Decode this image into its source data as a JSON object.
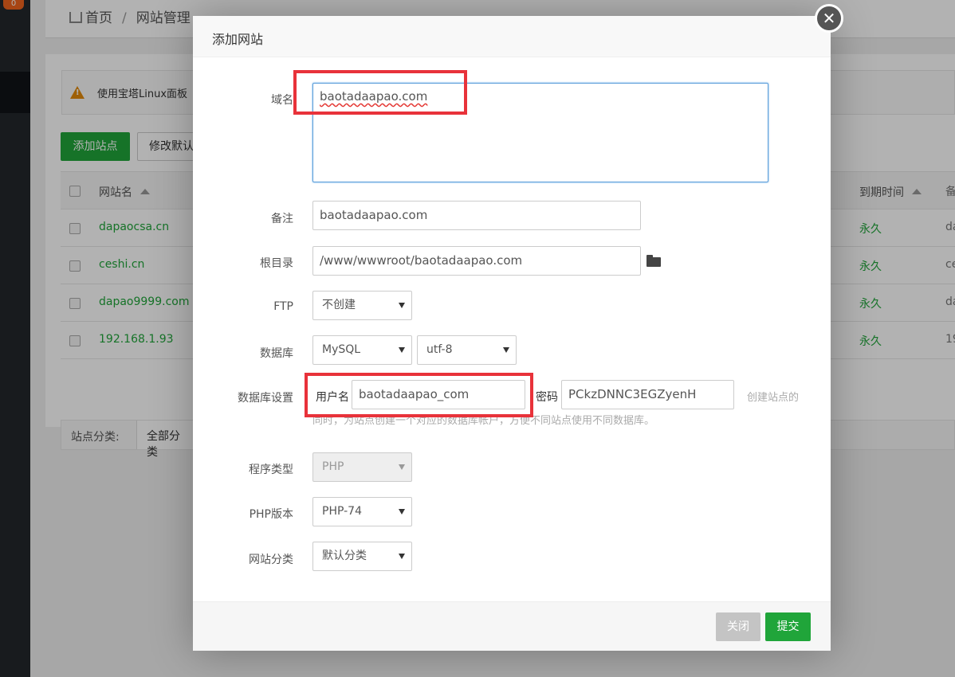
{
  "sidebar": {
    "badge": "0"
  },
  "breadcrumb": {
    "home": "首页",
    "separator": "/",
    "current": "网站管理"
  },
  "notice": {
    "text": "使用宝塔Linux面板"
  },
  "toolbar": {
    "add_site": "添加站点",
    "modify_default": "修改默认"
  },
  "table": {
    "header": {
      "name": "网站名",
      "expire": "到期时间",
      "remark": "备"
    },
    "rows": [
      {
        "name": "dapaocsa.cn",
        "expire": "永久",
        "remark": "da"
      },
      {
        "name": "ceshi.cn",
        "expire": "永久",
        "remark": "ce"
      },
      {
        "name": "dapao9999.com",
        "expire": "永久",
        "remark": "da"
      },
      {
        "name": "192.168.1.93",
        "expire": "永久",
        "remark": "19"
      }
    ]
  },
  "category_bar": {
    "label": "站点分类:",
    "value": "全部分类"
  },
  "modal": {
    "title": "添加网站",
    "close_glyph": "✕",
    "domain": {
      "label": "域名",
      "value": "baotadaapao.com"
    },
    "remark": {
      "label": "备注",
      "value": "baotadaapao.com"
    },
    "root": {
      "label": "根目录",
      "value": "/www/wwwroot/baotadaapao.com"
    },
    "ftp": {
      "label": "FTP",
      "value": "不创建"
    },
    "database": {
      "label": "数据库",
      "type": "MySQL",
      "charset": "utf-8"
    },
    "db_settings": {
      "label": "数据库设置",
      "user_label": "用户名",
      "user_value": "baotadaapao_com",
      "pass_label": "密码",
      "pass_value": "PCkzDNNC3EGZyenH",
      "hint_line1": "创建站点的",
      "hint_line2": "同时，为站点创建一个对应的数据库帐户，方便不同站点使用不同数据库。"
    },
    "program_type": {
      "label": "程序类型",
      "value": "PHP"
    },
    "php_version": {
      "label": "PHP版本",
      "value": "PHP-74"
    },
    "site_category": {
      "label": "网站分类",
      "value": "默认分类"
    },
    "buttons": {
      "close": "关闭",
      "submit": "提交"
    }
  },
  "colors": {
    "accent": "#20a53a",
    "highlight": "#e8323a",
    "focus": "#5b9dd9"
  }
}
